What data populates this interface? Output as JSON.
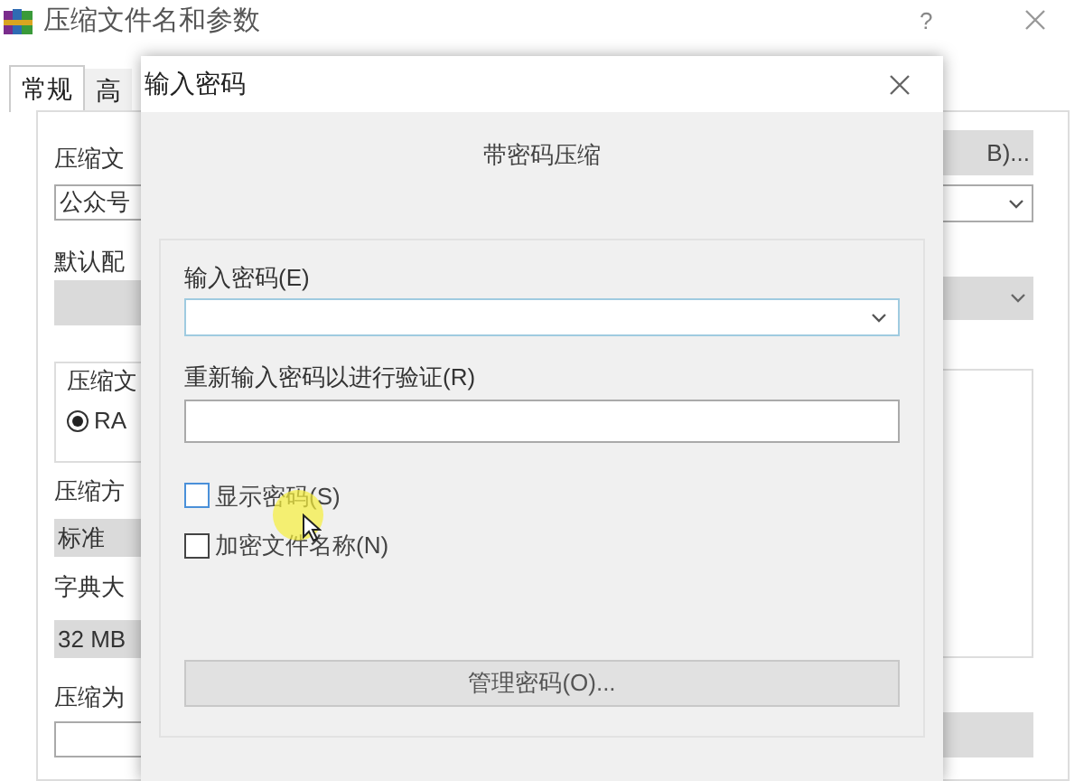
{
  "window": {
    "title": "压缩文件名和参数",
    "help": "?",
    "tabs": [
      {
        "label": "常规",
        "selected": true
      },
      {
        "label": "高",
        "selected": false
      }
    ],
    "left_column": [
      {
        "kind": "label",
        "text": "压缩文"
      },
      {
        "kind": "input",
        "value": "公众号"
      },
      {
        "kind": "label",
        "text": "默认配"
      },
      {
        "kind": "dropdown"
      },
      {
        "kind": "group",
        "label": "压缩文",
        "radio": {
          "label": "RA",
          "selected": true
        }
      },
      {
        "kind": "label",
        "text": "压缩方"
      },
      {
        "kind": "dropdown",
        "value": "标准"
      },
      {
        "kind": "label",
        "text": "字典大"
      },
      {
        "kind": "dropdown",
        "value": "32 MB"
      },
      {
        "kind": "label",
        "text": "压缩为"
      },
      {
        "kind": "input"
      }
    ],
    "right_column": [
      {
        "kind": "button",
        "label": "B)..."
      },
      {
        "kind": "combo"
      },
      {
        "kind": "dropdown"
      },
      {
        "kind": "group"
      },
      {
        "kind": "button"
      }
    ]
  },
  "dialog": {
    "title": "输入密码",
    "heading": "带密码压缩",
    "password": {
      "label": "输入密码(E)"
    },
    "confirm": {
      "label": "重新输入密码以进行验证(R)"
    },
    "checkboxes": [
      {
        "label": "显示密码(S)",
        "checked": false
      },
      {
        "label": "加密文件名称(N)",
        "checked": false
      }
    ],
    "manage_button": "管理密码(O)..."
  }
}
